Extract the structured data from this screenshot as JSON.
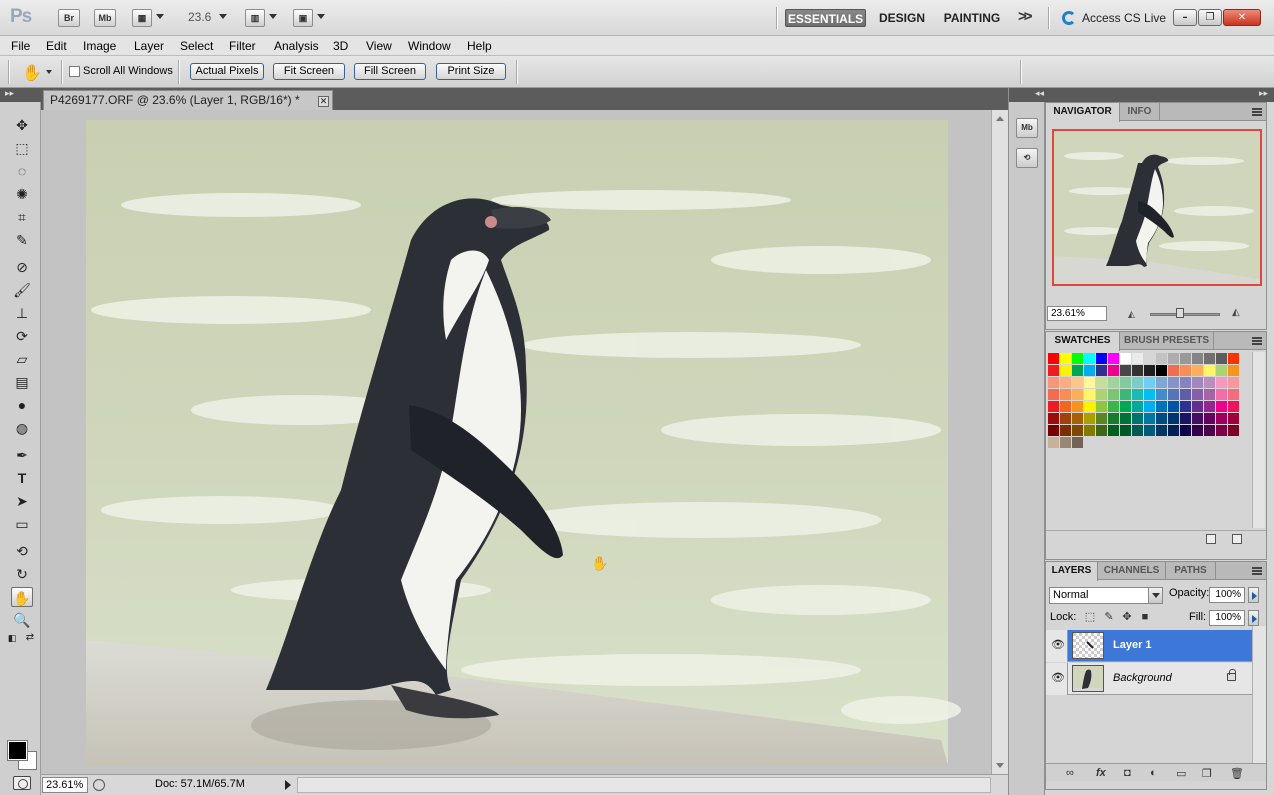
{
  "app": {
    "logo": "Ps",
    "launch_bridge": "Br",
    "launch_minibridge": "Mb",
    "zoom_value": "23.6",
    "workspaces": [
      "ESSENTIALS",
      "DESIGN",
      "PAINTING"
    ],
    "more_label": ">>",
    "cs_live": "Access CS Live",
    "window_buttons": {
      "minimize": "–",
      "restore": "❐",
      "close": "✕"
    }
  },
  "menu": [
    "File",
    "Edit",
    "Image",
    "Layer",
    "Select",
    "Filter",
    "Analysis",
    "3D",
    "View",
    "Window",
    "Help"
  ],
  "options": {
    "tool_icon": "hand-icon",
    "scroll_all_windows": "Scroll All Windows",
    "buttons": [
      "Actual Pixels",
      "Fit Screen",
      "Fill Screen",
      "Print Size"
    ]
  },
  "document": {
    "tab_title": "P4269177.ORF @ 23.6% (Layer 1, RGB/16*) *",
    "status_zoom": "23.61%",
    "status_doc": "Doc: 57.1M/65.7M"
  },
  "tools": [
    "move",
    "marquee",
    "lasso",
    "quick-select",
    "crop",
    "eyedropper",
    "spot-heal",
    "brush",
    "clone-stamp",
    "history-brush",
    "eraser",
    "gradient",
    "blur",
    "dodge",
    "pen",
    "type",
    "path-select",
    "shape",
    "3d-rotate",
    "3d-orbit",
    "hand",
    "zoom"
  ],
  "dock": [
    "Mb",
    "⟲"
  ],
  "navigator": {
    "tabs": [
      "NAVIGATOR",
      "INFO"
    ],
    "zoom": "23.61%"
  },
  "swatches": {
    "tabs": [
      "SWATCHES",
      "BRUSH PRESETS"
    ]
  },
  "layers": {
    "tabs": [
      "LAYERS",
      "CHANNELS",
      "PATHS"
    ],
    "blend_mode": "Normal",
    "opacity_label": "Opacity:",
    "opacity": "100%",
    "lock_label": "Lock:",
    "fill_label": "Fill:",
    "fill": "100%",
    "items": [
      {
        "name": "Layer 1",
        "selected": true
      },
      {
        "name": "Background",
        "selected": false
      }
    ]
  },
  "colors": {
    "accent": "#3d78d8",
    "highlight": "#e0473c"
  }
}
